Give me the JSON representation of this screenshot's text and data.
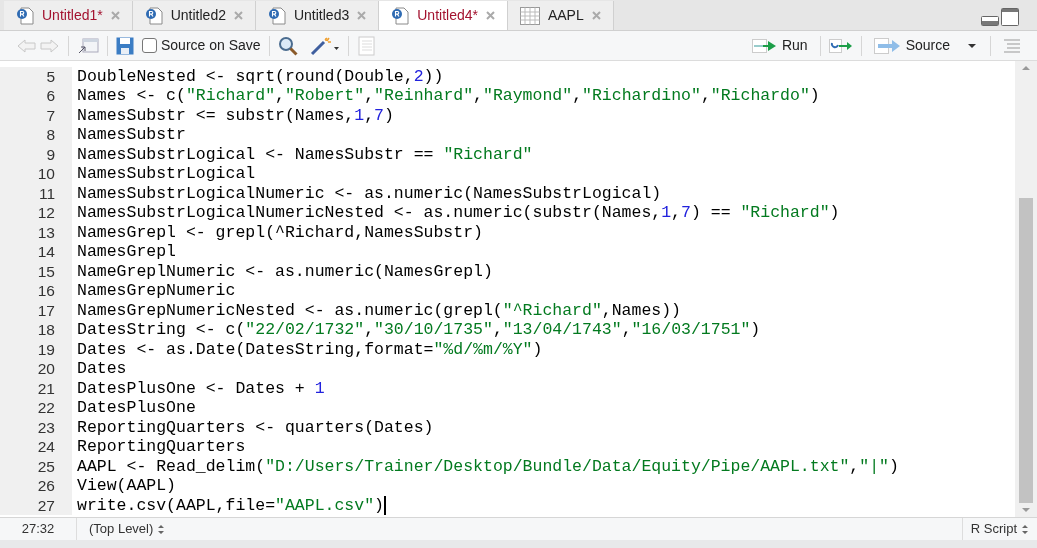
{
  "tabs": [
    {
      "label": "Untitled1*",
      "kind": "script",
      "modified": true,
      "selected": false
    },
    {
      "label": "Untitled2",
      "kind": "script",
      "modified": false,
      "selected": false
    },
    {
      "label": "Untitled3",
      "kind": "script",
      "modified": false,
      "selected": false
    },
    {
      "label": "Untitled4*",
      "kind": "script",
      "modified": true,
      "selected": true
    },
    {
      "label": "AAPL",
      "kind": "table",
      "modified": false,
      "selected": false
    }
  ],
  "toolbar": {
    "source_on_save": {
      "label": "Source on Save",
      "checked": false
    },
    "run": "Run",
    "source": "Source"
  },
  "editor": {
    "lines": [
      {
        "number": "5",
        "tokens": [
          {
            "kind": "text",
            "text": "DoubleNested <- sqrt(round(Double,"
          },
          {
            "kind": "number",
            "text": "2"
          },
          {
            "kind": "text",
            "text": "))"
          }
        ]
      },
      {
        "number": "6",
        "tokens": [
          {
            "kind": "text",
            "text": "Names <- c("
          },
          {
            "kind": "string",
            "text": "\"Richard\""
          },
          {
            "kind": "text",
            "text": ","
          },
          {
            "kind": "string",
            "text": "\"Robert\""
          },
          {
            "kind": "text",
            "text": ","
          },
          {
            "kind": "string",
            "text": "\"Reinhard\""
          },
          {
            "kind": "text",
            "text": ","
          },
          {
            "kind": "string",
            "text": "\"Raymond\""
          },
          {
            "kind": "text",
            "text": ","
          },
          {
            "kind": "string",
            "text": "\"Richardino\""
          },
          {
            "kind": "text",
            "text": ","
          },
          {
            "kind": "string",
            "text": "\"Richardo\""
          },
          {
            "kind": "text",
            "text": ")"
          }
        ]
      },
      {
        "number": "7",
        "tokens": [
          {
            "kind": "text",
            "text": "NamesSubstr <= substr(Names,"
          },
          {
            "kind": "number",
            "text": "1"
          },
          {
            "kind": "text",
            "text": ","
          },
          {
            "kind": "number",
            "text": "7"
          },
          {
            "kind": "text",
            "text": ")"
          }
        ]
      },
      {
        "number": "8",
        "tokens": [
          {
            "kind": "text",
            "text": "NamesSubstr"
          }
        ]
      },
      {
        "number": "9",
        "tokens": [
          {
            "kind": "text",
            "text": "NamesSubstrLogical <- NamesSubstr == "
          },
          {
            "kind": "string",
            "text": "\"Richard\""
          }
        ]
      },
      {
        "number": "10",
        "tokens": [
          {
            "kind": "text",
            "text": "NamesSubstrLogical"
          }
        ]
      },
      {
        "number": "11",
        "tokens": [
          {
            "kind": "text",
            "text": "NamesSubstrLogicalNumeric <- as.numeric(NamesSubstrLogical)"
          }
        ]
      },
      {
        "number": "12",
        "tokens": [
          {
            "kind": "text",
            "text": "NamesSubstrLogicalNumericNested <- as.numeric(substr(Names,"
          },
          {
            "kind": "number",
            "text": "1"
          },
          {
            "kind": "text",
            "text": ","
          },
          {
            "kind": "number",
            "text": "7"
          },
          {
            "kind": "text",
            "text": ") == "
          },
          {
            "kind": "string",
            "text": "\"Richard\""
          },
          {
            "kind": "text",
            "text": ")"
          }
        ]
      },
      {
        "number": "13",
        "tokens": [
          {
            "kind": "text",
            "text": "NamesGrepl <- grepl(^Richard,NamesSubstr)"
          }
        ]
      },
      {
        "number": "14",
        "tokens": [
          {
            "kind": "text",
            "text": "NamesGrepl"
          }
        ]
      },
      {
        "number": "15",
        "tokens": [
          {
            "kind": "text",
            "text": "NameGreplNumeric <- as.numeric(NamesGrepl)"
          }
        ]
      },
      {
        "number": "16",
        "tokens": [
          {
            "kind": "text",
            "text": "NamesGrepNumeric"
          }
        ]
      },
      {
        "number": "17",
        "tokens": [
          {
            "kind": "text",
            "text": "NamesGrepNumericNested <- as.numeric(grepl("
          },
          {
            "kind": "string",
            "text": "\"^Richard\""
          },
          {
            "kind": "text",
            "text": ",Names))"
          }
        ]
      },
      {
        "number": "18",
        "tokens": [
          {
            "kind": "text",
            "text": "DatesString <- c("
          },
          {
            "kind": "string",
            "text": "\"22/02/1732\""
          },
          {
            "kind": "text",
            "text": ","
          },
          {
            "kind": "string",
            "text": "\"30/10/1735\""
          },
          {
            "kind": "text",
            "text": ","
          },
          {
            "kind": "string",
            "text": "\"13/04/1743\""
          },
          {
            "kind": "text",
            "text": ","
          },
          {
            "kind": "string",
            "text": "\"16/03/1751\""
          },
          {
            "kind": "text",
            "text": ")"
          }
        ]
      },
      {
        "number": "19",
        "tokens": [
          {
            "kind": "text",
            "text": "Dates <- as.Date(DatesString,format="
          },
          {
            "kind": "string",
            "text": "\"%d/%m/%Y\""
          },
          {
            "kind": "text",
            "text": ")"
          }
        ]
      },
      {
        "number": "20",
        "tokens": [
          {
            "kind": "text",
            "text": "Dates"
          }
        ]
      },
      {
        "number": "21",
        "tokens": [
          {
            "kind": "text",
            "text": "DatesPlusOne <- Dates + "
          },
          {
            "kind": "number",
            "text": "1"
          }
        ]
      },
      {
        "number": "22",
        "tokens": [
          {
            "kind": "text",
            "text": "DatesPlusOne"
          }
        ]
      },
      {
        "number": "23",
        "tokens": [
          {
            "kind": "text",
            "text": "ReportingQuarters <- quarters(Dates)"
          }
        ]
      },
      {
        "number": "24",
        "tokens": [
          {
            "kind": "text",
            "text": "ReportingQuarters"
          }
        ]
      },
      {
        "number": "25",
        "tokens": [
          {
            "kind": "text",
            "text": "AAPL <- Read_delim("
          },
          {
            "kind": "string",
            "text": "\"D:/Users/Trainer/Desktop/Bundle/Data/Equity/Pipe/AAPL.txt\""
          },
          {
            "kind": "text",
            "text": ","
          },
          {
            "kind": "string",
            "text": "\"|\""
          },
          {
            "kind": "text",
            "text": ")"
          }
        ]
      },
      {
        "number": "26",
        "tokens": [
          {
            "kind": "text",
            "text": "View(AAPL)"
          }
        ]
      },
      {
        "number": "27",
        "tokens": [
          {
            "kind": "text",
            "text": "write.csv(AAPL,file="
          },
          {
            "kind": "string",
            "text": "\"AAPL.csv\""
          },
          {
            "kind": "text",
            "text": ")"
          }
        ],
        "cursor": true
      }
    ]
  },
  "status_bar": {
    "position": "27:32",
    "scope": "(Top Level)",
    "file_type": "R Script"
  }
}
